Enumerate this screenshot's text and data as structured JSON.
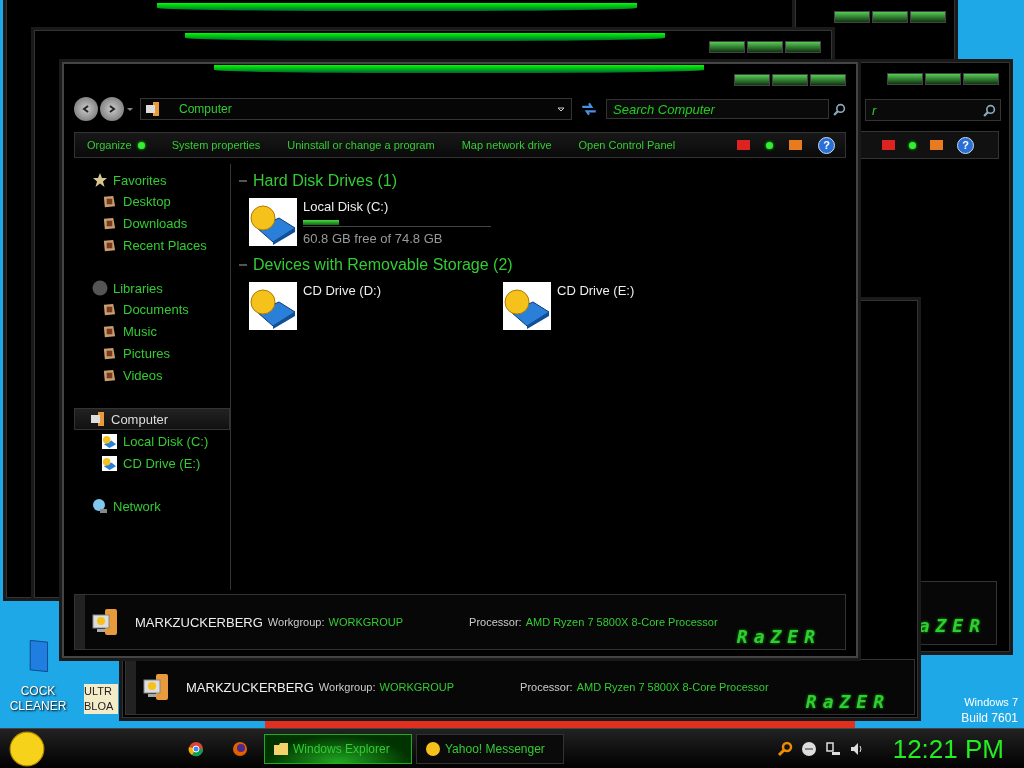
{
  "desktop": {
    "icons": [
      {
        "lines": [
          "COCK",
          "CLEANER"
        ]
      },
      {
        "lines": [
          "ULTR",
          "BLOA"
        ]
      }
    ],
    "os_label": [
      "Windows 7",
      "Build 7601"
    ]
  },
  "back_window": {
    "computer_name": "MARKZUCKERBERG",
    "workgroup_label": "Workgroup:",
    "workgroup": "WORKGROUP",
    "processor_label": "Processor:",
    "processor": "AMD Ryzen 7 5800X 8-Core Processor",
    "logo": "RaZER"
  },
  "right_window": {
    "search_placeholder": "r",
    "help": "?",
    "logo": "aZER"
  },
  "window": {
    "address": "Computer",
    "search_placeholder": "Search Computer",
    "toolbar": [
      {
        "label": "Organize",
        "dot": true
      },
      {
        "label": "System properties",
        "dot": false
      },
      {
        "label": "Uninstall or change a program",
        "dot": false
      },
      {
        "label": "Map network drive",
        "dot": false
      },
      {
        "label": "Open Control Panel",
        "dot": false
      }
    ],
    "help": "?",
    "sidebar": [
      {
        "label": "Favorites",
        "kind": "favorites",
        "selected": false,
        "children": [
          {
            "label": "Desktop",
            "kind": "place"
          },
          {
            "label": "Downloads",
            "kind": "place"
          },
          {
            "label": "Recent Places",
            "kind": "place"
          }
        ]
      },
      {
        "label": "Libraries",
        "kind": "libraries",
        "selected": false,
        "children": [
          {
            "label": "Documents",
            "kind": "place"
          },
          {
            "label": "Music",
            "kind": "place"
          },
          {
            "label": "Pictures",
            "kind": "place"
          },
          {
            "label": "Videos",
            "kind": "place"
          }
        ]
      },
      {
        "label": "Computer",
        "kind": "computer",
        "selected": true,
        "children": [
          {
            "label": "Local Disk (C:)",
            "kind": "drive"
          },
          {
            "label": "CD Drive (E:)",
            "kind": "drive"
          }
        ]
      },
      {
        "label": "Network",
        "kind": "network",
        "selected": false
      }
    ],
    "sections": [
      {
        "title": "Hard Disk Drives (1)",
        "items": [
          {
            "name": "Local Disk (C:)",
            "level": 0.19,
            "detail": "60.8 GB free of 74.8 GB"
          }
        ]
      },
      {
        "title": "Devices with Removable Storage (2)",
        "items": [
          {
            "name": "CD Drive (D:)"
          },
          {
            "name": "CD Drive (E:)"
          }
        ]
      }
    ],
    "footer": {
      "computer_name": "MARKZUCKERBERG",
      "workgroup_label": "Workgroup:",
      "workgroup": "WORKGROUP",
      "processor_label": "Processor:",
      "processor": "AMD Ryzen 7 5800X 8-Core Processor",
      "logo": "RaZER"
    }
  },
  "taskbar": {
    "items": [
      {
        "kind": "chrome",
        "selected": false
      },
      {
        "kind": "firefox",
        "selected": false
      },
      {
        "label": "Windows Explorer",
        "kind": "folder",
        "selected": true
      },
      {
        "label": "Yahoo! Messenger",
        "kind": "messenger",
        "selected": false
      }
    ],
    "clock": "12:21 PM"
  }
}
